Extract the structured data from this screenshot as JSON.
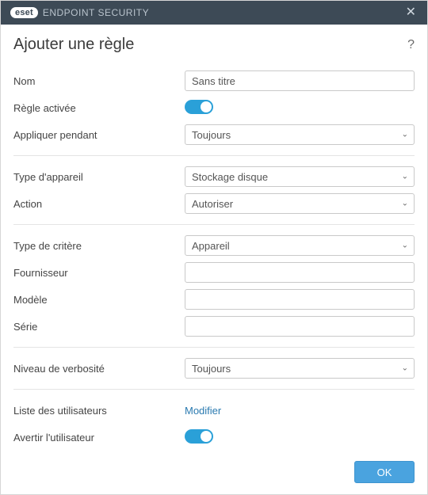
{
  "titlebar": {
    "brand_badge": "eset",
    "brand_text": "ENDPOINT SECURITY",
    "close_label": "✕"
  },
  "header": {
    "title": "Ajouter une règle",
    "help_symbol": "?"
  },
  "form": {
    "name": {
      "label": "Nom",
      "value": "Sans titre"
    },
    "rule_enabled": {
      "label": "Règle activée",
      "value": true
    },
    "apply_during": {
      "label": "Appliquer pendant",
      "selected": "Toujours"
    },
    "device_type": {
      "label": "Type d'appareil",
      "selected": "Stockage disque"
    },
    "action": {
      "label": "Action",
      "selected": "Autoriser"
    },
    "criteria_type": {
      "label": "Type de critère",
      "selected": "Appareil"
    },
    "vendor": {
      "label": "Fournisseur",
      "value": ""
    },
    "model": {
      "label": "Modèle",
      "value": ""
    },
    "serial": {
      "label": "Série",
      "value": ""
    },
    "verbosity": {
      "label": "Niveau de verbosité",
      "selected": "Toujours"
    },
    "user_list": {
      "label": "Liste des utilisateurs",
      "link_text": "Modifier"
    },
    "notify_user": {
      "label": "Avertir l'utilisateur",
      "value": true
    }
  },
  "footer": {
    "ok_label": "OK"
  }
}
